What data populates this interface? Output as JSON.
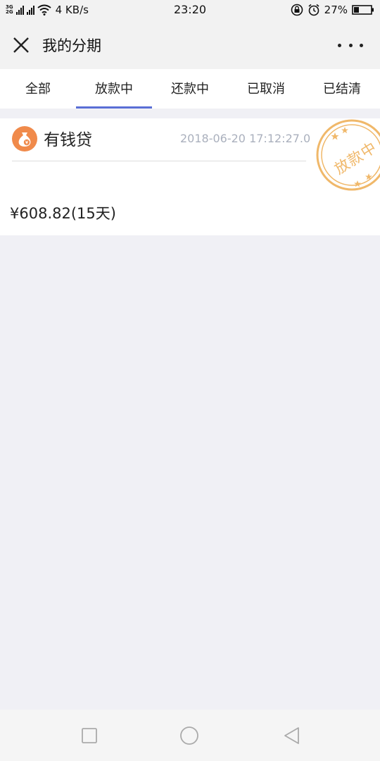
{
  "status_bar": {
    "net_top": "3G",
    "net_bottom": "2G",
    "speed": "4 KB/s",
    "time": "23:20",
    "battery": "27%"
  },
  "header": {
    "title": "我的分期"
  },
  "tabs": [
    {
      "label": "全部",
      "active": false
    },
    {
      "label": "放款中",
      "active": true
    },
    {
      "label": "还款中",
      "active": false
    },
    {
      "label": "已取消",
      "active": false
    },
    {
      "label": "已结清",
      "active": false
    }
  ],
  "card": {
    "lender": "有钱贷",
    "time": "2018-06-20 17:12:27.0",
    "amount": "¥608.82(15天)",
    "stamp": "放款中"
  },
  "colors": {
    "accent": "#5a6fd6",
    "stamp": "#f0b86a",
    "lender_icon": "#f08a4b",
    "background": "#f0f0f5"
  }
}
